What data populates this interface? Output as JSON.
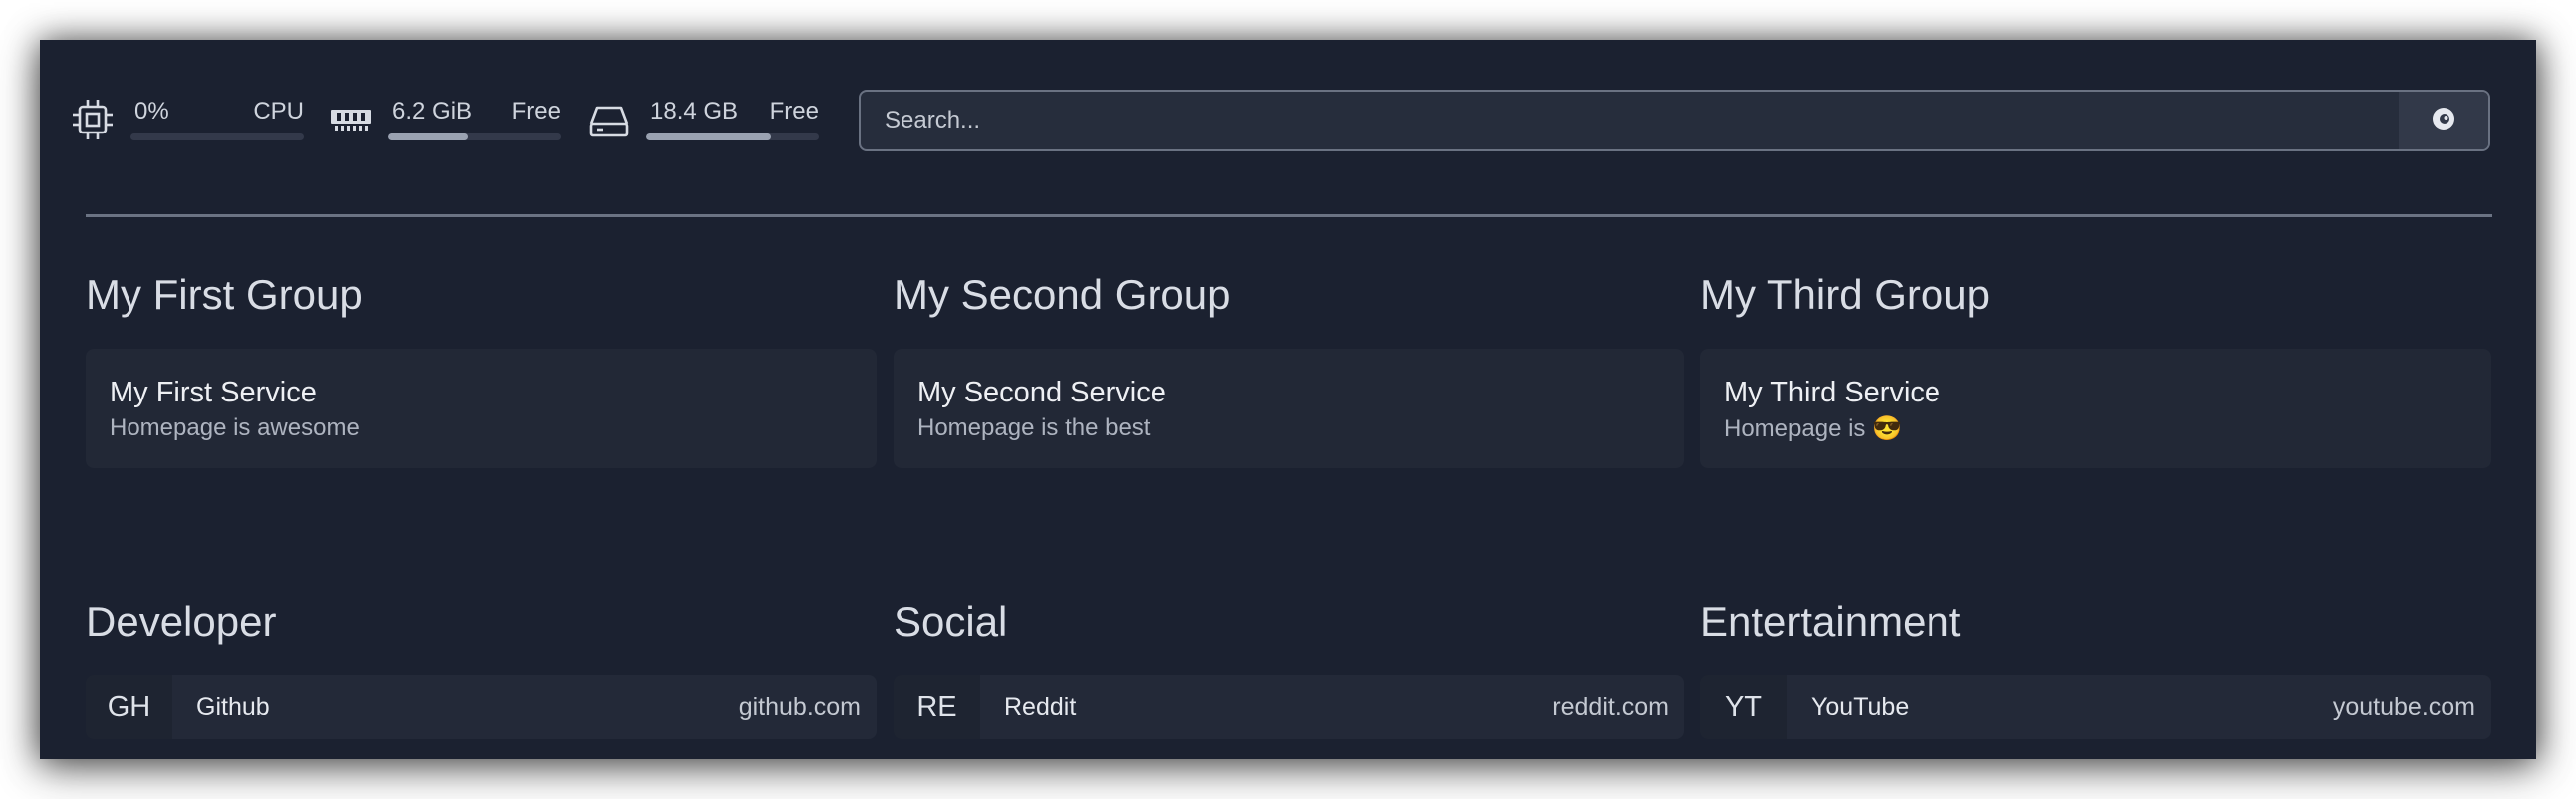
{
  "resources": {
    "cpu": {
      "value": "0%",
      "label": "CPU",
      "usage": 0.0
    },
    "memory": {
      "value": "6.2 GiB",
      "label": "Free",
      "usage": 0.46
    },
    "disk": {
      "value": "18.4 GB",
      "label": "Free",
      "usage": 0.72
    }
  },
  "search": {
    "placeholder": "Search...",
    "provider_icon": "search-provider-icon"
  },
  "service_groups": [
    {
      "title": "My First Group",
      "service": {
        "name": "My First Service",
        "description": "Homepage is awesome"
      }
    },
    {
      "title": "My Second Group",
      "service": {
        "name": "My Second Service",
        "description": "Homepage is the best"
      }
    },
    {
      "title": "My Third Group",
      "service": {
        "name": "My Third Service",
        "description": "Homepage is 😎"
      }
    }
  ],
  "bookmark_groups": [
    {
      "title": "Developer",
      "bookmark": {
        "abbr": "GH",
        "name": "Github",
        "url": "github.com"
      }
    },
    {
      "title": "Social",
      "bookmark": {
        "abbr": "RE",
        "name": "Reddit",
        "url": "reddit.com"
      }
    },
    {
      "title": "Entertainment",
      "bookmark": {
        "abbr": "YT",
        "name": "YouTube",
        "url": "youtube.com"
      }
    }
  ],
  "colors": {
    "background": "#1b2130",
    "card": "#222836",
    "border": "#6b7383",
    "text": "#e6e9ef"
  }
}
